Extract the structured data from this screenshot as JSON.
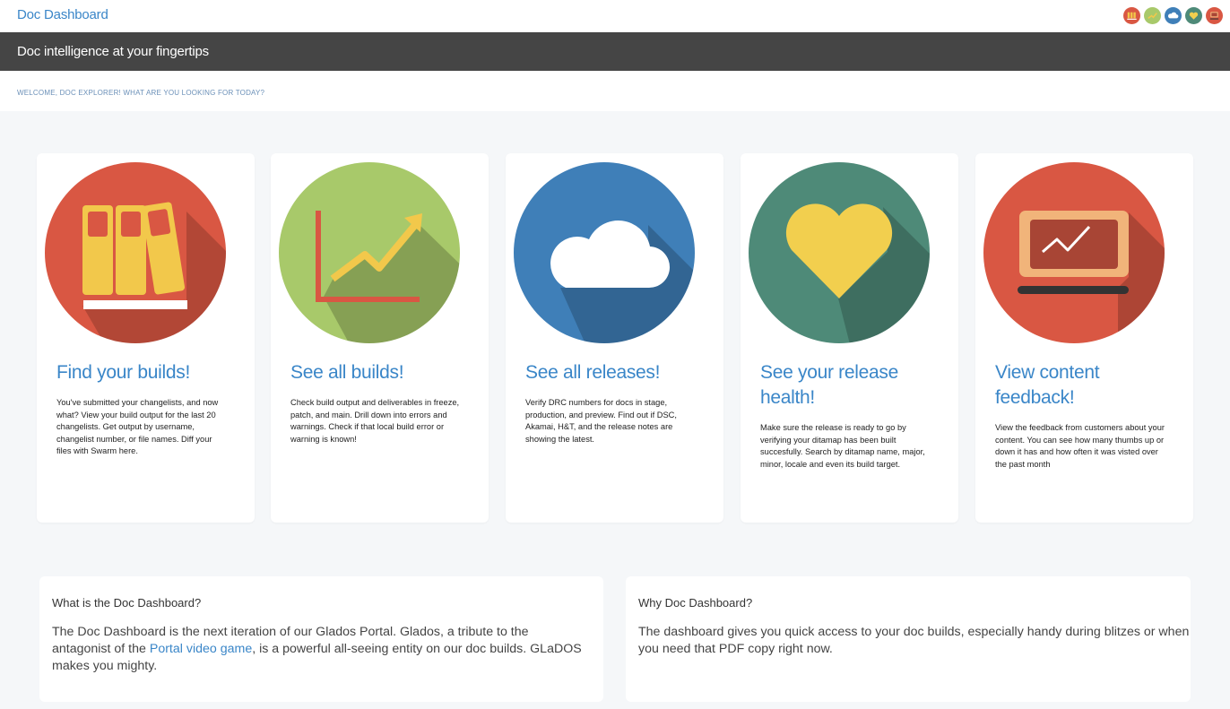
{
  "header": {
    "brand": "Doc Dashboard",
    "icons": [
      "books-icon",
      "chart-icon",
      "cloud-icon",
      "heart-icon",
      "laptop-icon"
    ]
  },
  "banner": {
    "tagline": "Doc intelligence at your fingertips"
  },
  "welcome": {
    "text": "WELCOME, DOC EXPLORER! WHAT ARE YOU LOOKING FOR TODAY?"
  },
  "cards": [
    {
      "title": "Find your builds!",
      "description": "You've submitted your changelists, and now what? View your build output for the last 20 changelists. Get output by username, changelist number, or file names. Diff your files with Swarm here.",
      "icon": "books-icon",
      "color": "#d95743"
    },
    {
      "title": "See all builds!",
      "description": "Check build output and deliverables in freeze, patch, and main. Drill down into errors and warnings. Check if that local build error or warning is known!",
      "icon": "growth-chart-icon",
      "color": "#a8c96a"
    },
    {
      "title": "See all releases!",
      "description": "Verify DRC numbers for docs in stage, production, and preview. Find out if DSC, Akamai, H&T, and the release notes are showing the latest.",
      "icon": "cloud-icon",
      "color": "#3f7fb8"
    },
    {
      "title": "See your release health!",
      "description": "Make sure the release is ready to go by verifying your ditamap has been built succesfully. Search by ditamap name, major, minor, locale and even its build target.",
      "icon": "heart-icon",
      "color": "#4e8a78"
    },
    {
      "title": "View content feedback!",
      "description": "View the feedback from customers about your content. You can see how many thumbs up or down it has and how often it was visted over the past month",
      "icon": "laptop-chart-icon",
      "color": "#d95743"
    }
  ],
  "info": {
    "what": {
      "title": "What is the Doc Dashboard?",
      "text_before": "The Doc Dashboard is the next iteration of our Glados Portal. Glados, a tribute to the antagonist of the ",
      "link": "Portal video game",
      "text_after": ", is a powerful all-seeing entity on our doc builds. GLaDOS makes you mighty."
    },
    "why": {
      "title": "Why Doc Dashboard?",
      "text": "The dashboard gives you quick access to your doc builds, especially handy during blitzes or when you need that PDF copy right now."
    }
  }
}
